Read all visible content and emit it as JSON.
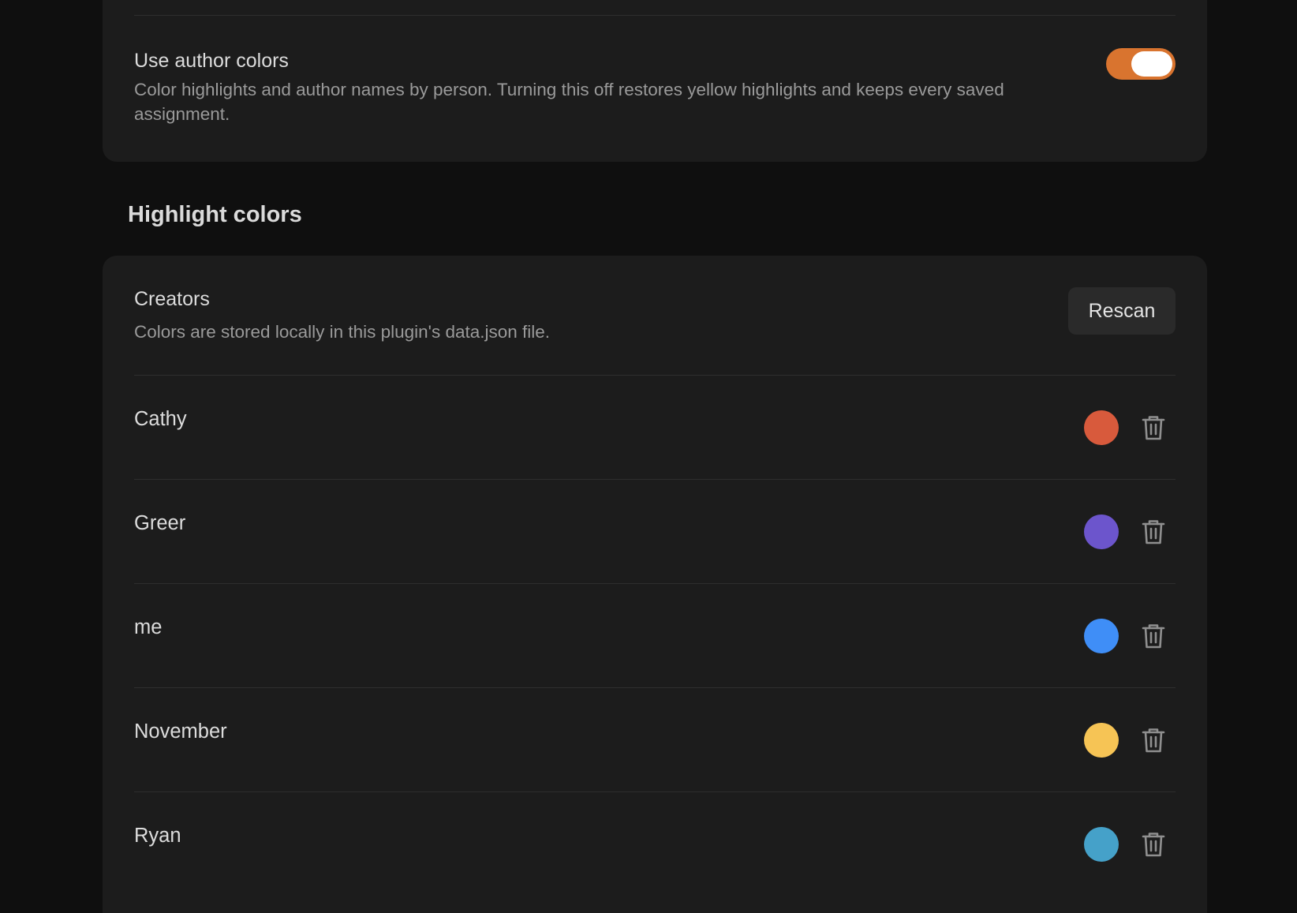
{
  "author_colors": {
    "title": "Use author colors",
    "description": "Color highlights and author names by person. Turning this off restores yellow highlights and keeps every saved assignment.",
    "enabled": true,
    "toggle_color": "#d9742f"
  },
  "highlight_colors": {
    "heading": "Highlight colors",
    "creators": {
      "title": "Creators",
      "description": "Colors are stored locally in this plugin's data.json file.",
      "rescan_label": "Rescan"
    },
    "items": [
      {
        "name": "Cathy",
        "color": "#d85a3c",
        "delete_icon": "trash-icon"
      },
      {
        "name": "Greer",
        "color": "#6c55cc",
        "delete_icon": "trash-icon"
      },
      {
        "name": "me",
        "color": "#3f8ef7",
        "delete_icon": "trash-icon"
      },
      {
        "name": "November",
        "color": "#f6c455",
        "delete_icon": "trash-icon"
      },
      {
        "name": "Ryan",
        "color": "#45a1c9",
        "delete_icon": "trash-icon"
      }
    ]
  }
}
